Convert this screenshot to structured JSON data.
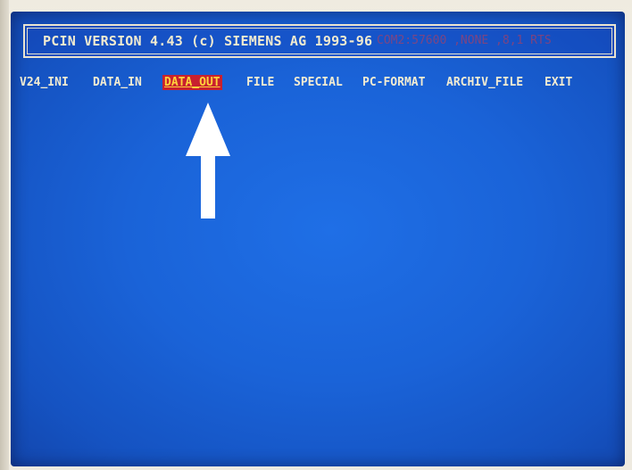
{
  "title_bar": {
    "title": "PCIN VERSION 4.43 (c) SIEMENS AG 1993-96",
    "status": "COM2:57600 ,NONE ,8,1 RTS"
  },
  "menu": {
    "items": [
      {
        "label": "V24_INI"
      },
      {
        "label": "DATA_IN"
      },
      {
        "label": "DATA_OUT",
        "selected": true
      },
      {
        "label": "FILE"
      },
      {
        "label": "SPECIAL"
      },
      {
        "label": "PC-FORMAT"
      },
      {
        "label": "ARCHIV_FILE"
      },
      {
        "label": "EXIT"
      }
    ]
  },
  "annotation": {
    "icon": "up-arrow-icon"
  },
  "colors": {
    "screen_background": "#1a63d8",
    "text": "#f3ecd2",
    "selected_background": "#c8212f",
    "selected_text": "#ffd23c",
    "status_text": "#d13b4a",
    "arrow": "#ffffff"
  }
}
